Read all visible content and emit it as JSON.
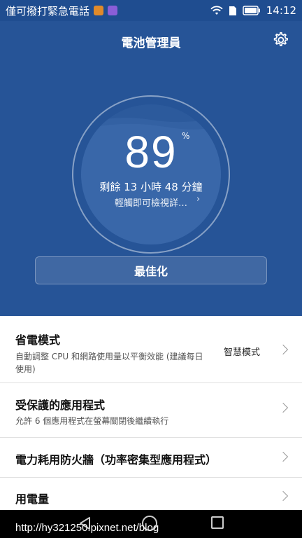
{
  "status_bar": {
    "carrier_text": "僅可撥打緊急電話",
    "time": "14:12",
    "icons": [
      "notification-app-icon",
      "notification-gallery-icon",
      "wifi-icon",
      "sim-icon",
      "battery-icon"
    ]
  },
  "header": {
    "title": "電池管理員",
    "settings_icon": "gear-icon"
  },
  "battery": {
    "percent": "89",
    "percent_sign": "%",
    "level": 0.89,
    "remaining": "剩餘 13 小時 48 分鐘",
    "view_details": "輕觸即可檢視詳…",
    "details_chevron": "›"
  },
  "optimize_button": {
    "label": "最佳化"
  },
  "settings_list": [
    {
      "title": "省電模式",
      "desc": "自動調整 CPU 和網路使用量以平衡效能 (建議每日使用)",
      "value": "智慧模式"
    },
    {
      "title": "受保護的應用程式",
      "desc": "允許 6 個應用程式在螢幕關閉後繼續執行"
    },
    {
      "title": "電力耗用防火牆（功率密集型應用程式）"
    },
    {
      "title": "用電量"
    }
  ],
  "watermark": "http://hy321250.pixnet.net/blog",
  "colors": {
    "hero_blue": "#265497",
    "status_blue": "#1f4d90"
  }
}
